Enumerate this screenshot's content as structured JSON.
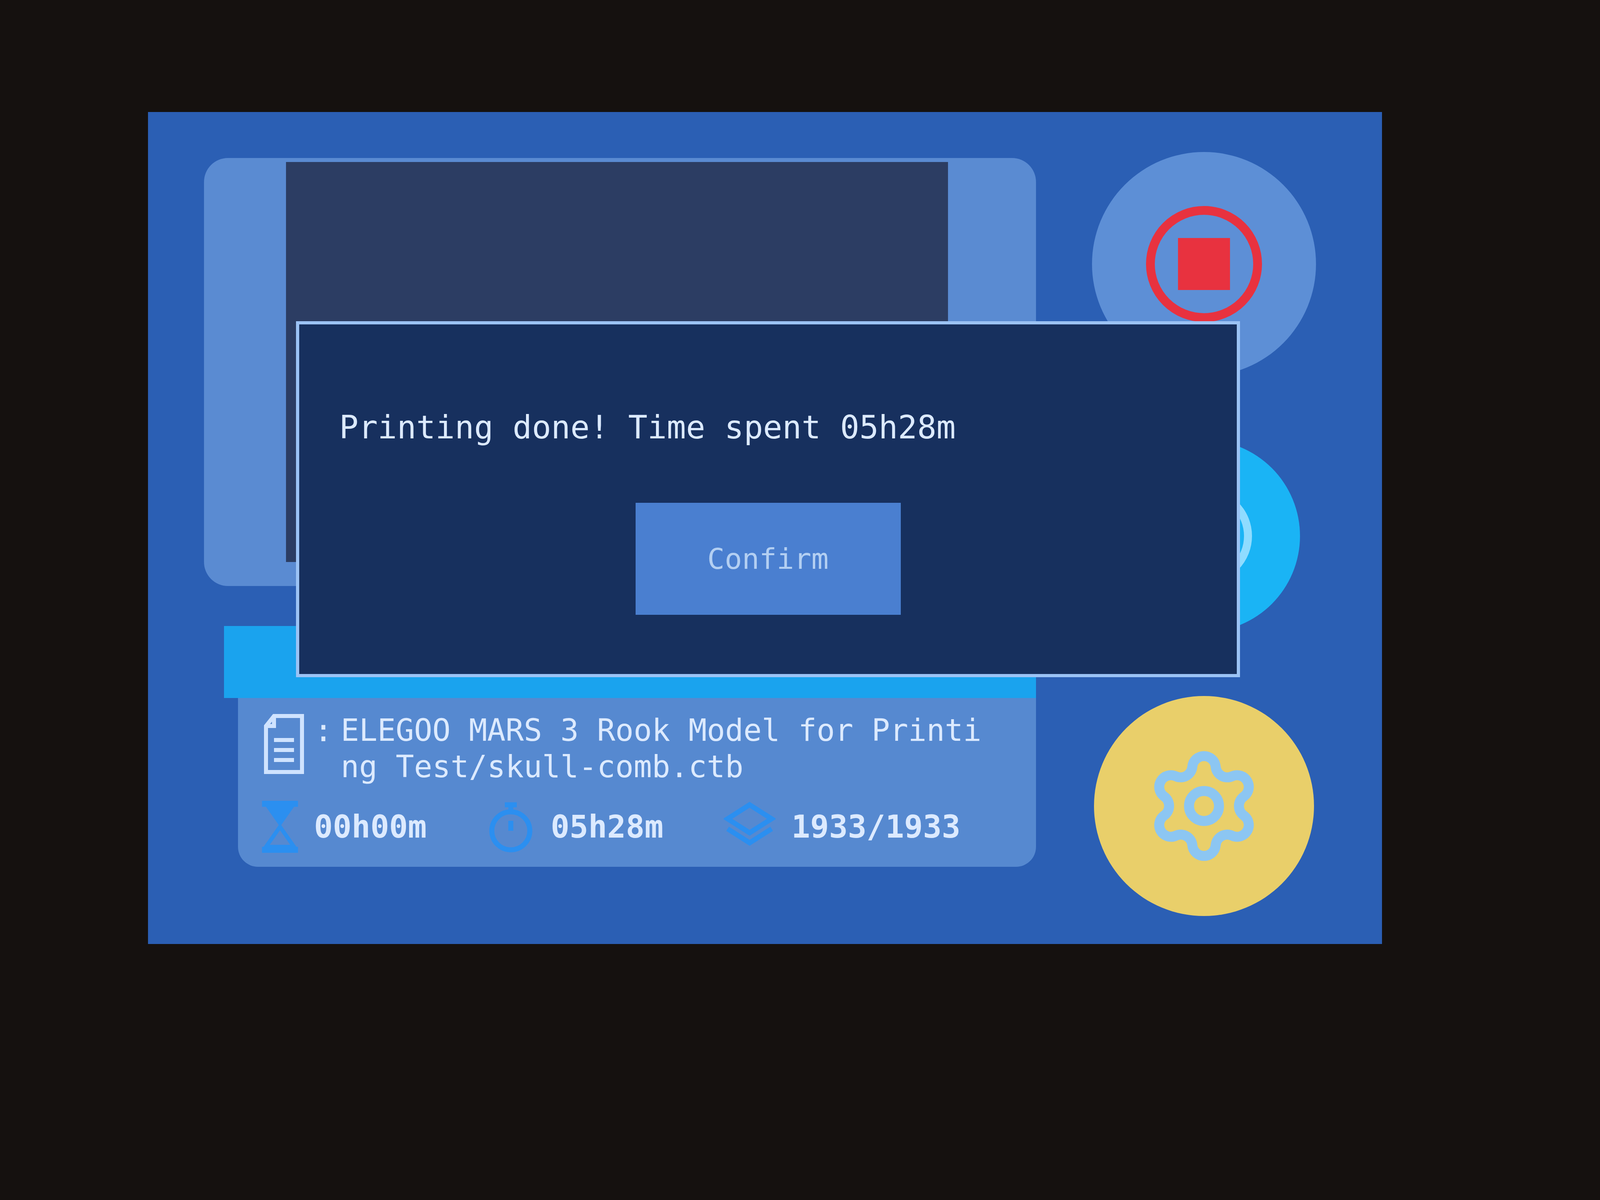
{
  "dialog": {
    "message": "Printing done! Time spent 05h28m",
    "button": "Confirm"
  },
  "file": {
    "separator": ":",
    "name": "ELEGOO MARS 3 Rook Model for Printing Test/skull-comb.ctb"
  },
  "progress": {
    "level": 1
  },
  "stats": [
    {
      "kind": "remaining",
      "value": "00h00m"
    },
    {
      "kind": "elapsed",
      "value": "05h28m"
    },
    {
      "kind": "layers",
      "value": "1933/1933"
    }
  ]
}
